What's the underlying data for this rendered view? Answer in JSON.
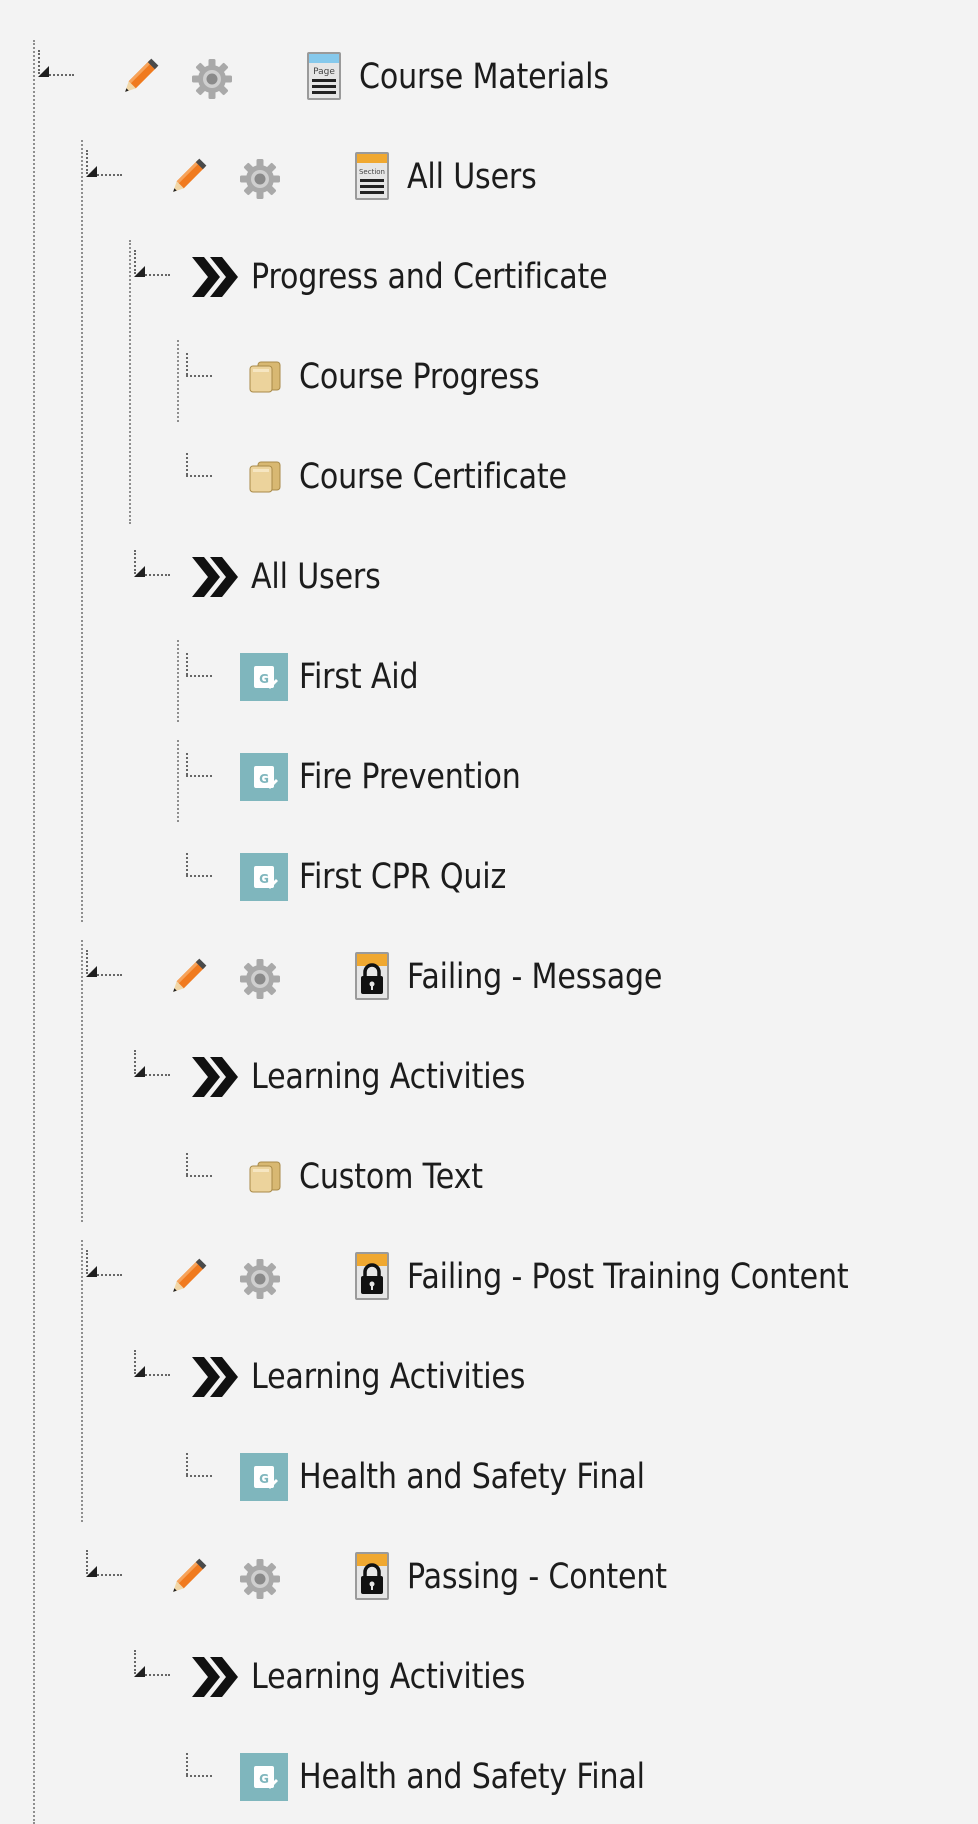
{
  "tree": {
    "root": {
      "label": "Course Materials",
      "type_badge": "Page",
      "icons": [
        "pencil-edit-icon",
        "gear-settings-icon",
        "page-icon"
      ]
    },
    "items": [
      {
        "label": "All Users",
        "type_badge": "Section",
        "icon": "section-icon"
      },
      {
        "label": "Progress and Certificate",
        "icon": "double-chevron-icon"
      },
      {
        "label": "Course Progress",
        "icon": "folder-icon"
      },
      {
        "label": "Course Certificate",
        "icon": "folder-icon"
      },
      {
        "label": "All Users",
        "icon": "double-chevron-icon"
      },
      {
        "label": "First Aid",
        "icon": "course-module-icon"
      },
      {
        "label": "Fire Prevention",
        "icon": "course-module-icon"
      },
      {
        "label": "First CPR Quiz",
        "icon": "course-module-icon"
      },
      {
        "label": "Failing - Message",
        "icon": "locked-section-icon"
      },
      {
        "label": "Learning Activities",
        "icon": "double-chevron-icon"
      },
      {
        "label": "Custom Text",
        "icon": "folder-icon"
      },
      {
        "label": "Failing - Post Training Content",
        "icon": "locked-section-icon"
      },
      {
        "label": "Learning Activities",
        "icon": "double-chevron-icon"
      },
      {
        "label": "Health and Safety Final",
        "icon": "course-module-icon"
      },
      {
        "label": "Passing - Content",
        "icon": "locked-section-icon"
      },
      {
        "label": "Learning Activities",
        "icon": "double-chevron-icon"
      },
      {
        "label": "Health and Safety Final",
        "icon": "course-module-icon"
      }
    ]
  },
  "colors": {
    "background": "#f3f3f3",
    "pencil": "#f07a1e",
    "gear": "#a9a9a9",
    "module_tile": "#7fb6bd",
    "folder": "#e6c98a",
    "lock_header": "#f0a830",
    "page_header": "#86c9ec",
    "text": "#1c1c1c"
  }
}
